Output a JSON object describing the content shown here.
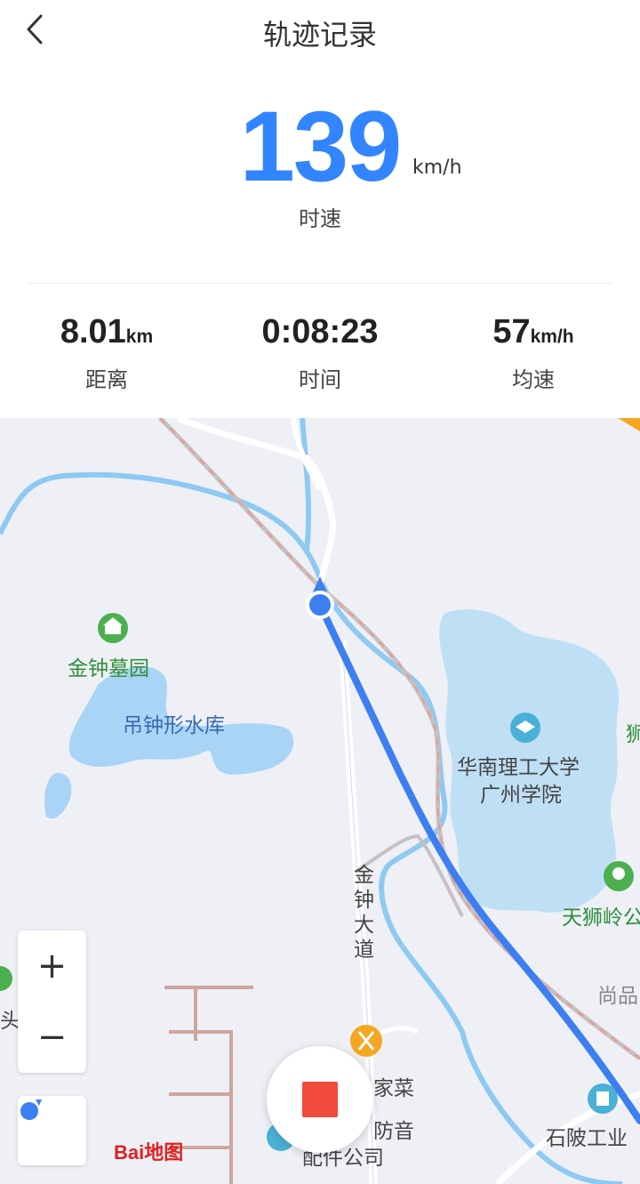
{
  "header": {
    "title": "轨迹记录"
  },
  "speed": {
    "value": "139",
    "unit": "km/h",
    "label": "时速"
  },
  "stats": [
    {
      "value": "8.01",
      "unit": "km",
      "label": "距离"
    },
    {
      "value": "0:08:23",
      "unit": "",
      "label": "时间"
    },
    {
      "value": "57",
      "unit": "km/h",
      "label": "均速"
    }
  ],
  "map": {
    "labels": {
      "jinzhong_cemetery": "金钟墓园",
      "reservoir": "吊钟形水库",
      "university_1": "华南理工大学",
      "university_2": "广州学院",
      "jinzhong_road": "金钟大道",
      "tianshiling": "天狮岭公",
      "shangpin": "尚品",
      "shiling": "石陂工业",
      "jiacai": "家菜",
      "fangyin_1": "防音",
      "fangyin_2": "配件公司",
      "edge_right": "狮",
      "edge_left": "头"
    },
    "zoom_in_label": "+",
    "zoom_out_label": "−",
    "logo_text": "Bai地图",
    "colors": {
      "route": "#3d7ff0",
      "water": "#a9d4f5",
      "river": "#8ec9f2",
      "accent": "#3385ff",
      "stop": "#f24a3c"
    }
  }
}
